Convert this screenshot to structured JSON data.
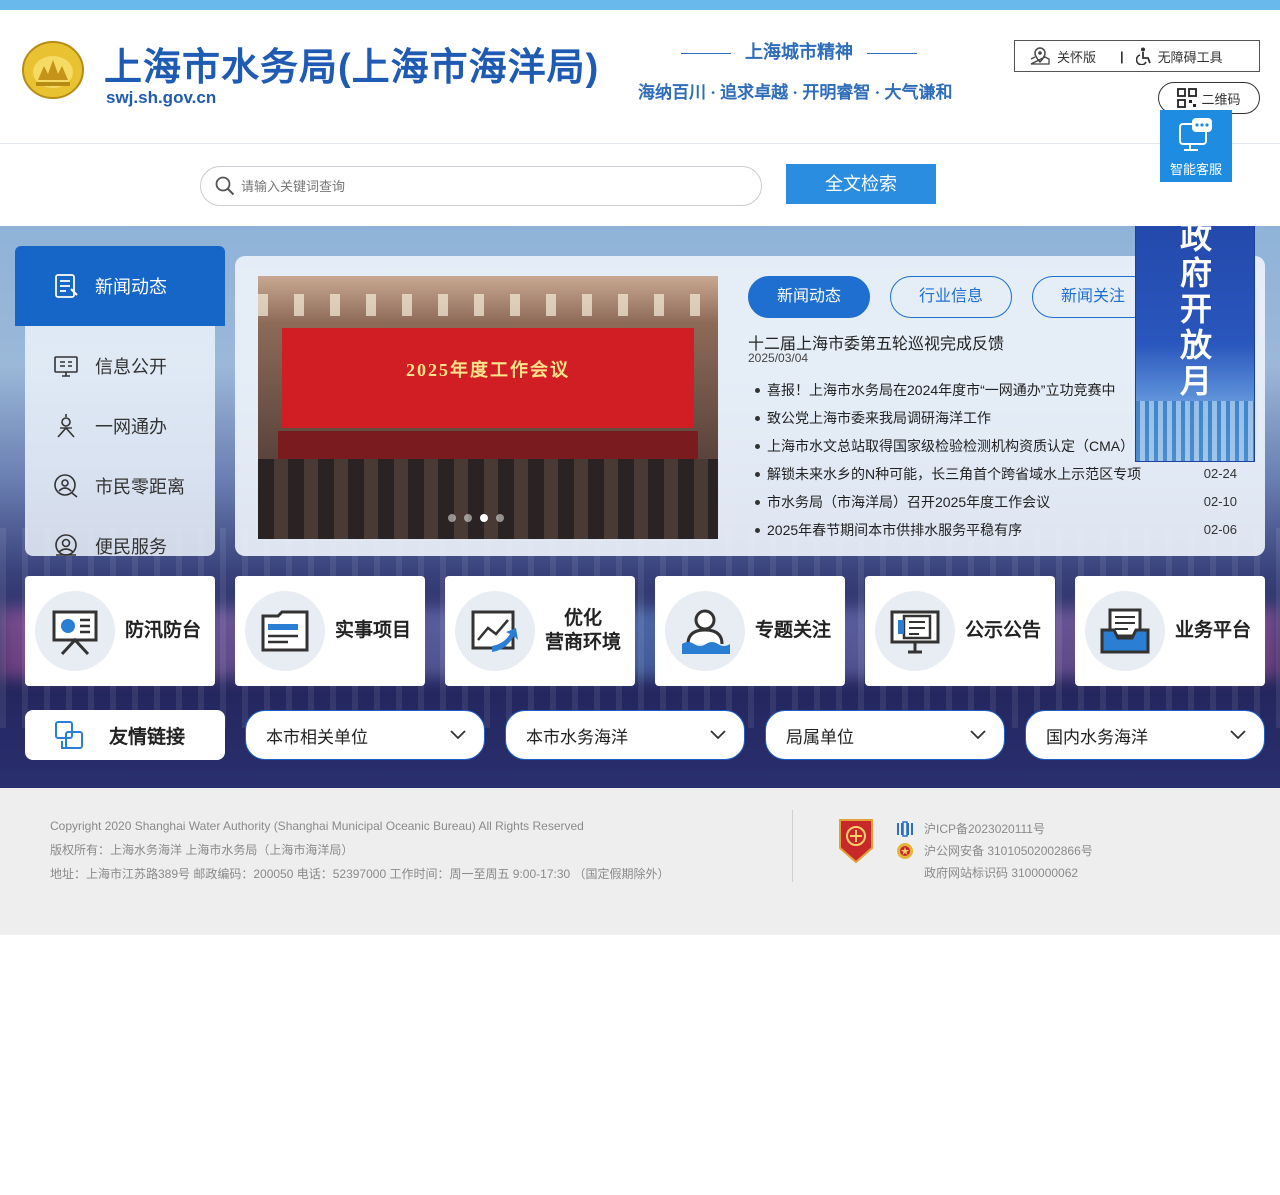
{
  "header": {
    "title": "上海市水务局(上海市海洋局)",
    "domain": "swj.sh.gov.cn",
    "spirit_title": "上海城市精神",
    "spirit_line": "海纳百川 · 追求卓越 · 开明睿智 · 大气谦和",
    "care_mode": "关怀版",
    "accessibility": "无障碍工具",
    "qr_code": "二维码",
    "assistant": "智能客服"
  },
  "search": {
    "placeholder": "请输入关键词查询",
    "button": "全文检索"
  },
  "nav": {
    "items": [
      {
        "label": "新闻动态",
        "icon": "news-icon"
      },
      {
        "label": "信息公开",
        "icon": "info-screen-icon"
      },
      {
        "label": "一网通办",
        "icon": "service-person-icon"
      },
      {
        "label": "市民零距离",
        "icon": "chat-person-icon"
      },
      {
        "label": "便民服务",
        "icon": "helpdesk-icon"
      }
    ]
  },
  "carousel": {
    "banner_text": "2025年度工作会议",
    "slide_count": 4,
    "active_slide": 3
  },
  "news": {
    "tabs": [
      "新闻动态",
      "行业信息",
      "新闻关注"
    ],
    "headline": "十二届上海市委第五轮巡视完成反馈",
    "headline_date": "2025/03/04",
    "items": [
      {
        "title": "喜报！上海市水务局在2024年度市“一网通办”立功竞赛中",
        "date": ""
      },
      {
        "title": "致公党上海市委来我局调研海洋工作",
        "date": ""
      },
      {
        "title": "上海市水文总站取得国家级检验检测机构资质认定（CMA）",
        "date": ""
      },
      {
        "title": "解锁未来水乡的N种可能，长三角首个跨省域水上示范区专项",
        "date": "02-24"
      },
      {
        "title": "市水务局（市海洋局）召开2025年度工作会议",
        "date": "02-10"
      },
      {
        "title": "2025年春节期间本市供排水服务平稳有序",
        "date": "02-06"
      }
    ]
  },
  "open_month": "政府开放月",
  "quick_links": [
    {
      "label": "防汛防台",
      "icon": "presentation-board-icon"
    },
    {
      "label": "实事项目",
      "icon": "folder-icon"
    },
    {
      "label": "优化\n营商环境",
      "icon": "trend-chart-icon"
    },
    {
      "label": "专题关注",
      "icon": "person-water-icon"
    },
    {
      "label": "公示公告",
      "icon": "monitor-document-icon"
    },
    {
      "label": "业务平台",
      "icon": "inbox-document-icon"
    }
  ],
  "links": {
    "friend_label": "友情链接",
    "dropdowns": [
      "本市相关单位",
      "本市水务海洋",
      "局属单位",
      "国内水务海洋"
    ]
  },
  "footer": {
    "copyright": "Copyright 2020 Shanghai Water Authority (Shanghai Municipal Oceanic Bureau) All Rights Reserved",
    "rights": "版权所有：上海水务海洋 上海市水务局（上海市海洋局）",
    "address": "地址：上海市江苏路389号 邮政编码：200050 电话：52397000 工作时间：周一至周五 9:00-17:30 （国定假期除外）",
    "icp": "沪ICP备2023020111号",
    "police": "沪公网安备 31010502002866号",
    "site_id": "政府网站标识码 3100000062"
  },
  "colors": {
    "brand": "#1f5bb3",
    "accent": "#1e6fd0",
    "topbar": "#6ab9ec"
  }
}
